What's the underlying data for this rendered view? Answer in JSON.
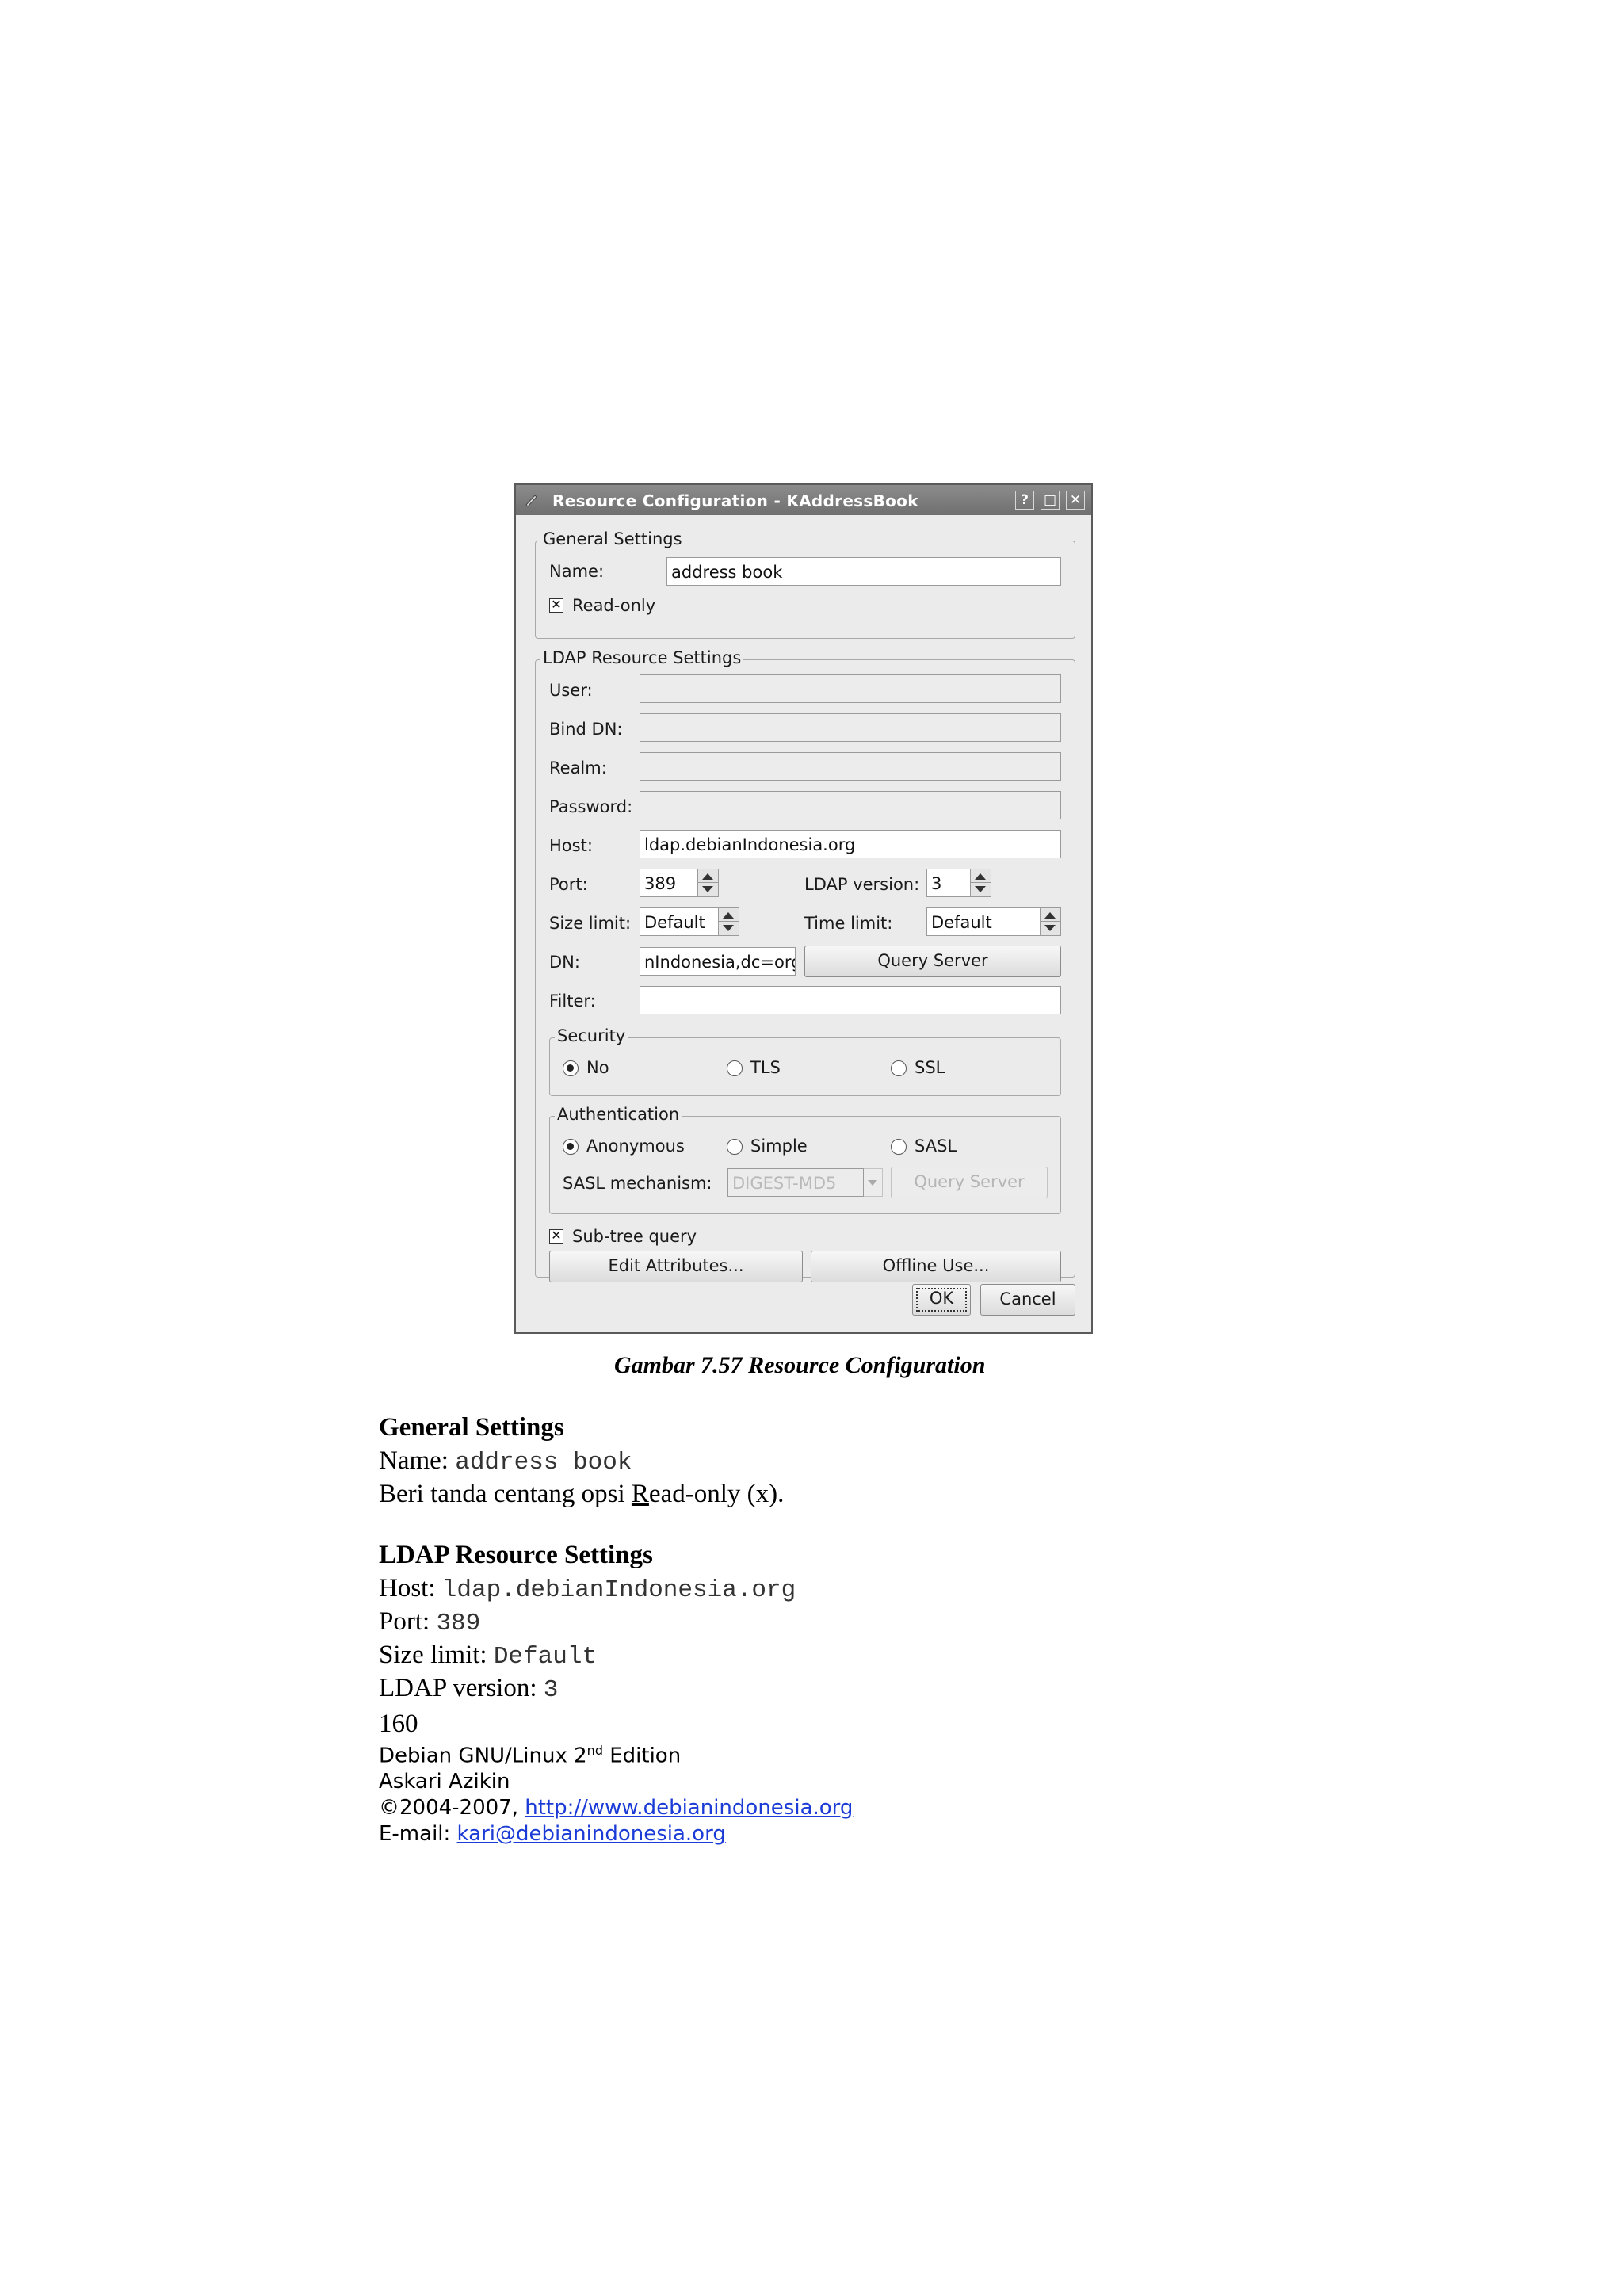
{
  "window": {
    "title": "Resource Configuration - KAddressBook",
    "buttons": {
      "help": "?",
      "maximize": "□",
      "close": "✕"
    }
  },
  "general": {
    "title": "General Settings",
    "name_label": "Name:",
    "name_value": "address book",
    "readonly_label": "Read-only",
    "readonly_checked": true
  },
  "ldap": {
    "title": "LDAP Resource Settings",
    "user_label": "User:",
    "binddn_label": "Bind DN:",
    "realm_label": "Realm:",
    "password_label": "Password:",
    "host_label": "Host:",
    "host_value": "ldap.debianIndonesia.org",
    "port_label": "Port:",
    "port_value": "389",
    "ldap_version_label": "LDAP version:",
    "ldap_version_value": "3",
    "size_limit_label": "Size limit:",
    "size_limit_value": "Default",
    "time_limit_label": "Time limit:",
    "time_limit_value": "Default",
    "dn_label": "DN:",
    "dn_value": "nIndonesia,dc=org",
    "query_server_label": "Query Server",
    "filter_label": "Filter:",
    "filter_value": "",
    "security": {
      "title": "Security",
      "options": [
        "No",
        "TLS",
        "SSL"
      ],
      "selected": "No"
    },
    "authentication": {
      "title": "Authentication",
      "options": [
        "Anonymous",
        "Simple",
        "SASL"
      ],
      "selected": "Anonymous",
      "sasl_mechanism_label": "SASL mechanism:",
      "sasl_mechanism_value": "DIGEST-MD5",
      "query_server_label": "Query Server"
    },
    "subtree_label": "Sub-tree query",
    "subtree_checked": true,
    "edit_attributes_label": "Edit Attributes...",
    "offline_use_label": "Offline Use..."
  },
  "dialog_buttons": {
    "ok": "OK",
    "cancel": "Cancel"
  },
  "caption": "Gambar 7.57 Resource Configuration",
  "doc": {
    "general_heading": "General Settings",
    "name_prefix": "Name: ",
    "name_value": "address book",
    "instruction_pre": "Beri tanda centang opsi ",
    "instruction_underlined": "R",
    "instruction_post": "ead-only (x).",
    "ldap_heading": "LDAP Resource Settings",
    "host_prefix": "Host: ",
    "host_value": "ldap.debianIndonesia.org",
    "port_prefix": "Port: ",
    "port_value": "389",
    "size_prefix": "Size limit: ",
    "size_value": "Default",
    "ldapver_prefix": "LDAP version: ",
    "ldapver_value": "3"
  },
  "footer": {
    "page_number": "160",
    "book_title_pre": "Debian GNU/Linux 2",
    "book_title_sup": "nd",
    "book_title_post": " Edition",
    "author": "Askari Azikin",
    "copyright_pre": "©2004-2007, ",
    "website": "http://www.debianindonesia.org",
    "email_pre": "E-mail: ",
    "email": "kari@debianindonesia.org"
  }
}
